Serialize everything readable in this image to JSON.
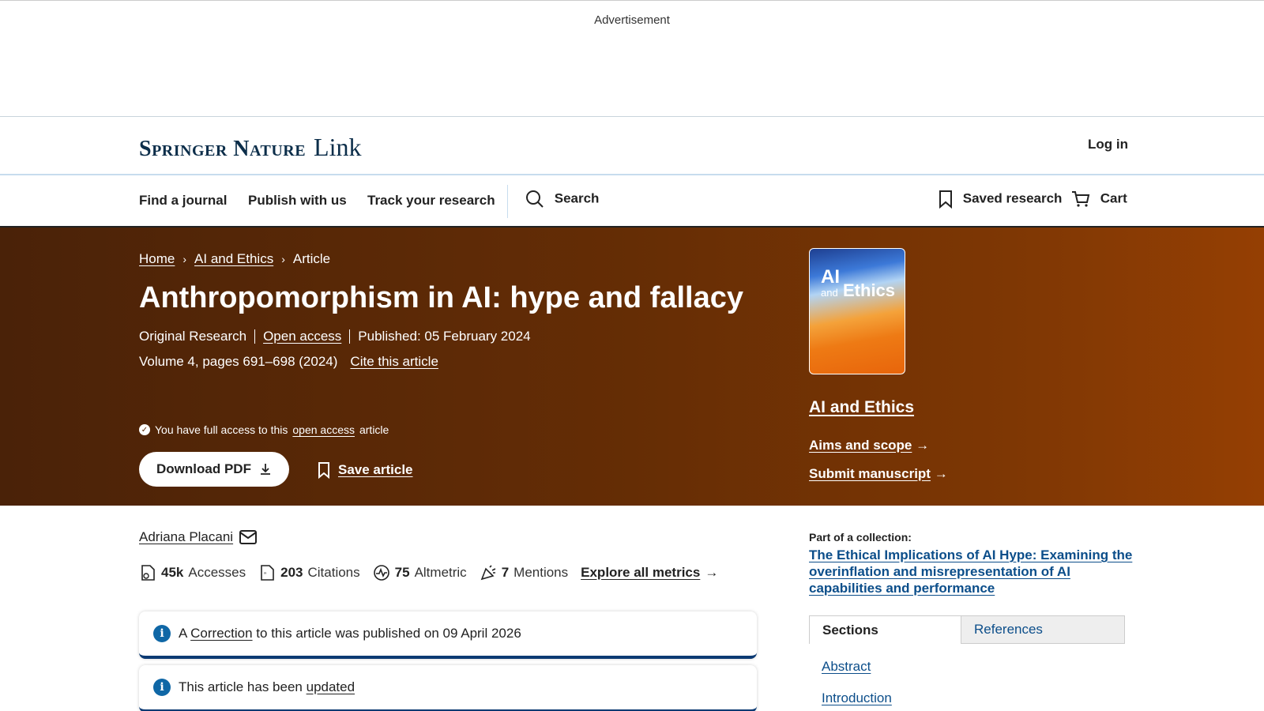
{
  "ad": {
    "label": "Advertisement"
  },
  "header": {
    "logo_main": "Springer Nature",
    "logo_sub": "Link",
    "login": "Log in"
  },
  "nav": {
    "find_journal": "Find a journal",
    "publish": "Publish with us",
    "track": "Track your research",
    "search": "Search",
    "saved": "Saved research",
    "cart": "Cart"
  },
  "breadcrumb": [
    "Home",
    "AI and Ethics",
    "Article"
  ],
  "article": {
    "title": "Anthropomorphism in AI: hype and fallacy",
    "type": "Original Research",
    "open_access": "Open access",
    "published": "Published: 05 February 2024",
    "volume": "Volume 4, pages 691–698 (2024)",
    "cite": "Cite this article",
    "access_prefix": "You have full access to this",
    "access_link": "open access",
    "access_suffix": "article",
    "download": "Download PDF",
    "save": "Save article"
  },
  "journal": {
    "cover_ai": "AI",
    "cover_and": "and",
    "cover_ethics": "Ethics",
    "name": "AI and Ethics",
    "aims": "Aims and scope",
    "submit": "Submit manuscript"
  },
  "author": {
    "name": "Adriana Placani"
  },
  "metrics": [
    {
      "value": "45k",
      "label": "Accesses",
      "icon": "accesses-icon"
    },
    {
      "value": "203",
      "label": "Citations",
      "icon": "citations-icon"
    },
    {
      "value": "75",
      "label": "Altmetric",
      "icon": "altmetric-icon"
    },
    {
      "value": "7",
      "label": "Mentions",
      "icon": "mentions-icon"
    }
  ],
  "explore_metrics": "Explore all metrics",
  "notices": {
    "correction_a": "A",
    "correction_link": "Correction",
    "correction_rest": "to this article was published on 09 April 2026",
    "updated_text": "This article has been",
    "updated_link": "updated"
  },
  "collection": {
    "label": "Part of a collection:",
    "title": "The Ethical Implications of AI Hype: Examining the overinflation and misrepresentation of AI capabilities and performance"
  },
  "tabs": [
    "Sections",
    "References"
  ],
  "sections": [
    "Abstract",
    "Introduction"
  ],
  "colors": {
    "hero_start": "#4a2208",
    "hero_end": "#953f03",
    "link_blue": "#0c4e8a",
    "notice_border": "#0c3a73"
  }
}
